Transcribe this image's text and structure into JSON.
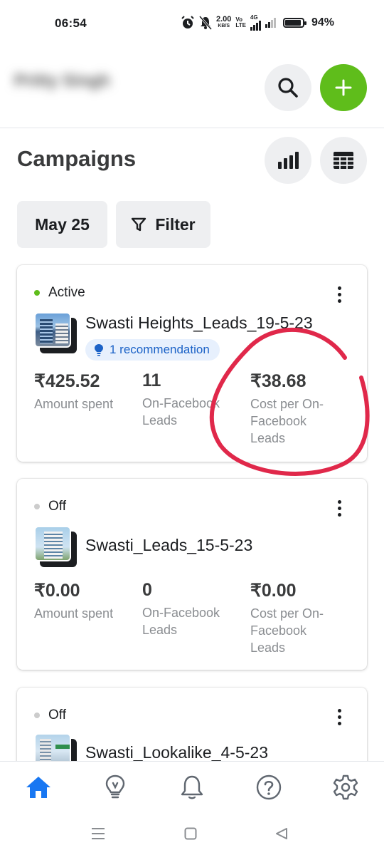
{
  "status_bar": {
    "time": "06:54",
    "net_speed_value": "2.00",
    "net_speed_unit": "KB/S",
    "volte_top": "Vo",
    "volte_bottom": "LTE",
    "network": "4G",
    "battery_percent": "94%",
    "battery_level": 0.94
  },
  "header": {
    "account_name": "Pritty Singh",
    "search_icon": "search-icon",
    "add_icon": "plus-icon",
    "add_color": "#5fbd1b"
  },
  "page": {
    "title": "Campaigns",
    "chart_icon": "bar-chart-icon",
    "table_icon": "table-icon",
    "date_pill": "May 25",
    "filter_label": "Filter"
  },
  "campaigns": [
    {
      "status": "Active",
      "status_color": "#5fbd1b",
      "name": "Swasti Heights_Leads_19-5-23",
      "recommendation": "1 recommendation",
      "metrics": [
        {
          "value": "₹425.52",
          "label": "Amount spent"
        },
        {
          "value": "11",
          "label": "On-Facebook Leads"
        },
        {
          "value": "₹38.68",
          "label": "Cost per On-Facebook Leads"
        }
      ]
    },
    {
      "status": "Off",
      "status_color": "#cccccc",
      "name": "Swasti_Leads_15-5-23",
      "metrics": [
        {
          "value": "₹0.00",
          "label": "Amount spent"
        },
        {
          "value": "0",
          "label": "On-Facebook Leads"
        },
        {
          "value": "₹0.00",
          "label": "Cost per On-Facebook Leads"
        }
      ]
    },
    {
      "status": "Off",
      "status_color": "#cccccc",
      "name": "Swasti_Lookalike_4-5-23"
    }
  ],
  "bottom_nav": {
    "items": [
      "home-icon",
      "lightbulb-icon",
      "bell-icon",
      "help-icon",
      "gear-icon"
    ],
    "active_color": "#1877f2"
  },
  "annotation_color": "#e0284a"
}
